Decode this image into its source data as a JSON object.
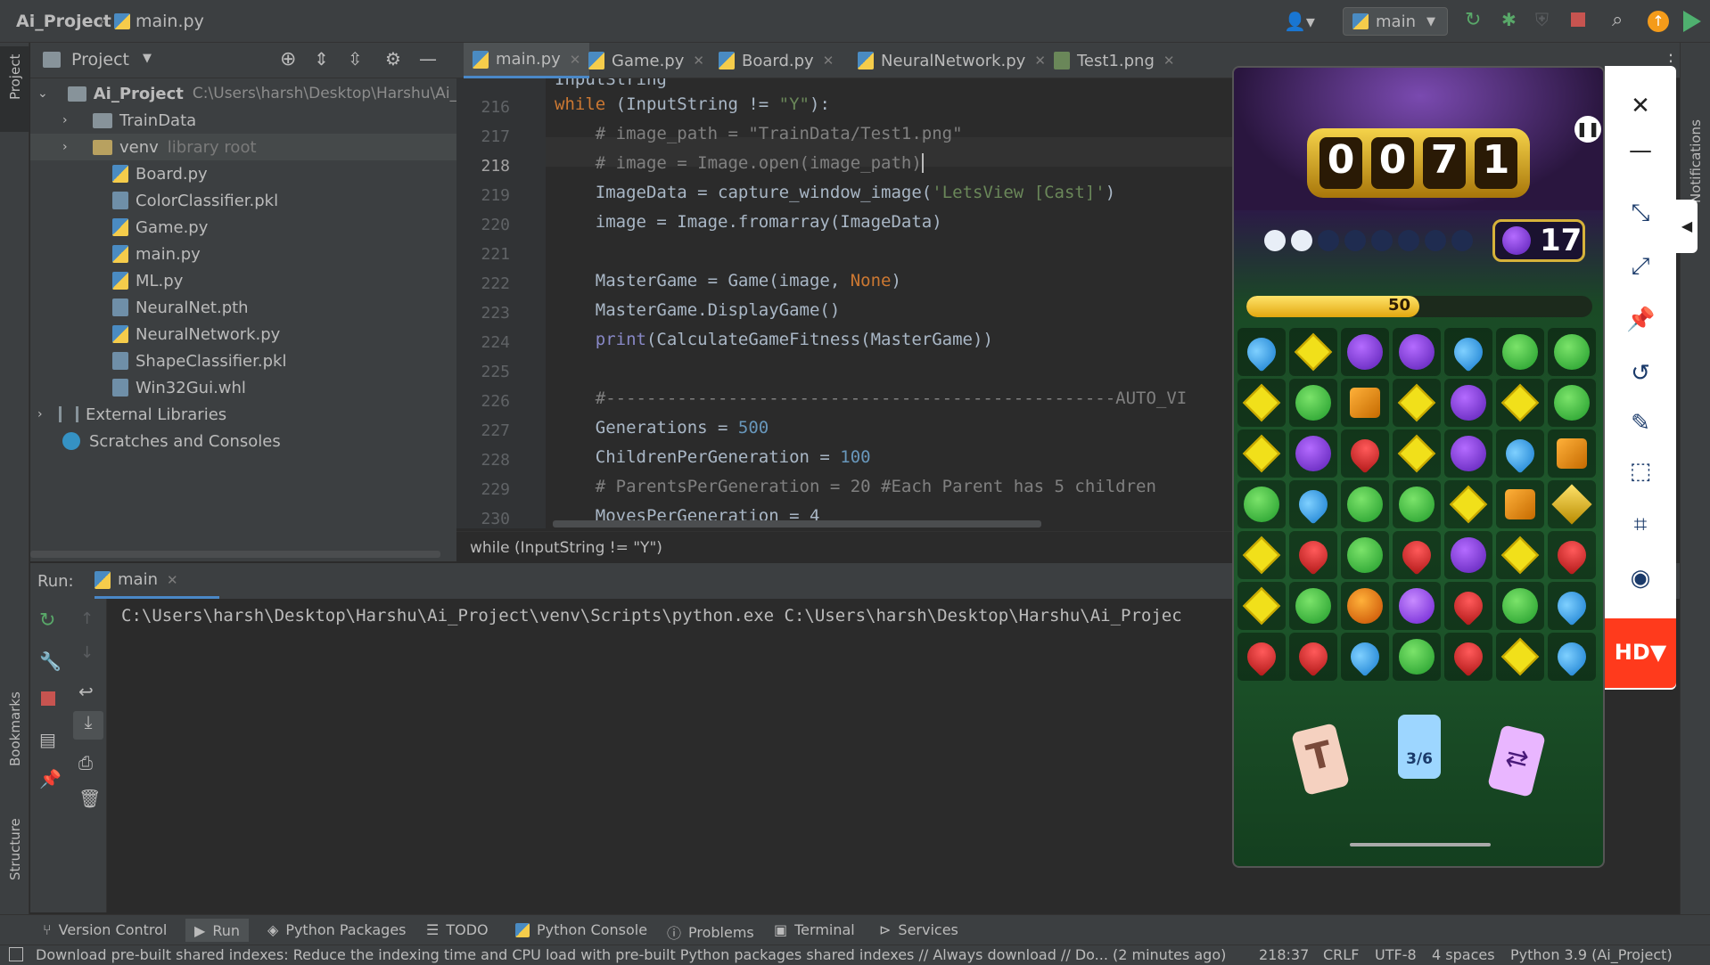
{
  "titlebar": {
    "project": "Ai_Project",
    "file": "main.py",
    "run_config": "main"
  },
  "left_strip": {
    "project_label": "Project",
    "bookmarks_label": "Bookmarks",
    "structure_label": "Structure"
  },
  "right_strip": {
    "notifications_label": "Notifications"
  },
  "project_panel": {
    "title": "Project",
    "root_name": "Ai_Project",
    "root_path": "C:\\Users\\harsh\\Desktop\\Harshu\\Ai_Proje",
    "items": [
      {
        "label": "TrainData",
        "kind": "folder"
      },
      {
        "label": "venv",
        "kind": "folder",
        "suffix": "library root"
      },
      {
        "label": "Board.py",
        "kind": "py"
      },
      {
        "label": "ColorClassifier.pkl",
        "kind": "pkl"
      },
      {
        "label": "Game.py",
        "kind": "py"
      },
      {
        "label": "main.py",
        "kind": "py"
      },
      {
        "label": "ML.py",
        "kind": "py"
      },
      {
        "label": "NeuralNet.pth",
        "kind": "pkl"
      },
      {
        "label": "NeuralNetwork.py",
        "kind": "py"
      },
      {
        "label": "ShapeClassifier.pkl",
        "kind": "pkl"
      },
      {
        "label": "Win32Gui.whl",
        "kind": "whl"
      }
    ],
    "external_libraries": "External Libraries",
    "scratches": "Scratches and Consoles"
  },
  "tabs": [
    "main.py",
    "Game.py",
    "Board.py",
    "NeuralNetwork.py",
    "Test1.png"
  ],
  "editor": {
    "partial_top": "InputString",
    "line_numbers": [
      "216",
      "217",
      "218",
      "219",
      "220",
      "221",
      "222",
      "223",
      "224",
      "225",
      "226",
      "227",
      "228",
      "229",
      "230"
    ],
    "breadcrumb": "while (InputString != \"Y\")"
  },
  "code_lines": [
    {
      "kw": "while",
      "rest": " (InputString != ",
      "str": "\"Y\"",
      "tail": "):"
    },
    {
      "cm": "    # image_path = \"TrainData/Test1.png\""
    },
    {
      "cm": "    # image = Image.open(image_path)"
    },
    {
      "plain": "    ImageData = capture_window_image(",
      "str": "'LetsView [Cast]'",
      "tail": ")"
    },
    {
      "plain": "    image = Image.fromarray(ImageData)"
    },
    {
      "plain": ""
    },
    {
      "plain": "    MasterGame = Game(image, ",
      "kw": "None",
      "tail": ")"
    },
    {
      "plain": "    MasterGame.DisplayGame()"
    },
    {
      "bi": "    print",
      "tail": "(CalculateGameFitness(MasterGame))"
    },
    {
      "plain": ""
    },
    {
      "cm": "    #--------------------------------------------------AUTO_VI"
    },
    {
      "plain": "    Generations = ",
      "num": "500"
    },
    {
      "plain": "    ChildrenPerGeneration = ",
      "num": "100"
    },
    {
      "cm": "    # ParentsPerGeneration = 20 #Each Parent has 5 children"
    },
    {
      "plain": "    MovesPerGeneration = 4"
    }
  ],
  "run": {
    "label": "Run:",
    "tab": "main",
    "output": "C:\\Users\\harsh\\Desktop\\Harshu\\Ai_Project\\venv\\Scripts\\python.exe C:\\Users\\harsh\\Desktop\\Harshu\\Ai_Projec"
  },
  "bottom_tools": [
    "Version Control",
    "Run",
    "Python Packages",
    "TODO",
    "Python Console",
    "Problems",
    "Terminal",
    "Services"
  ],
  "status": {
    "message": "Download pre-built shared indexes: Reduce the indexing time and CPU load with pre-built Python packages shared indexes // Always download // Do... (2 minutes ago)",
    "position": "218:37",
    "line_ending": "CRLF",
    "encoding": "UTF-8",
    "indent": "4 spaces",
    "interpreter": "Python 3.9 (Ai_Project)"
  },
  "game": {
    "score_digits": [
      "0",
      "0",
      "7",
      "1"
    ],
    "moves": "17",
    "progress_value": "50",
    "progress_fraction": 0.5,
    "counter_card": "3/6",
    "board": [
      [
        "spade",
        "diamond",
        "circle",
        "circle",
        "spade",
        "club",
        "club"
      ],
      [
        "diamond",
        "club",
        "box",
        "diamond",
        "circle",
        "diamond",
        "club"
      ],
      [
        "diamond",
        "circle",
        "heart",
        "diamond",
        "circle",
        "spade",
        "box"
      ],
      [
        "club",
        "spade",
        "club",
        "club",
        "diamond",
        "box",
        "gold"
      ],
      [
        "diamond",
        "heart",
        "club",
        "heart",
        "circle",
        "diamond",
        "heart"
      ],
      [
        "diamond",
        "club",
        "bomb",
        "vbomb",
        "heart",
        "club",
        "spade"
      ],
      [
        "heart",
        "heart",
        "spade",
        "club",
        "heart",
        "diamond",
        "spade"
      ]
    ]
  },
  "cast": {
    "hd_label": "HD▼"
  }
}
